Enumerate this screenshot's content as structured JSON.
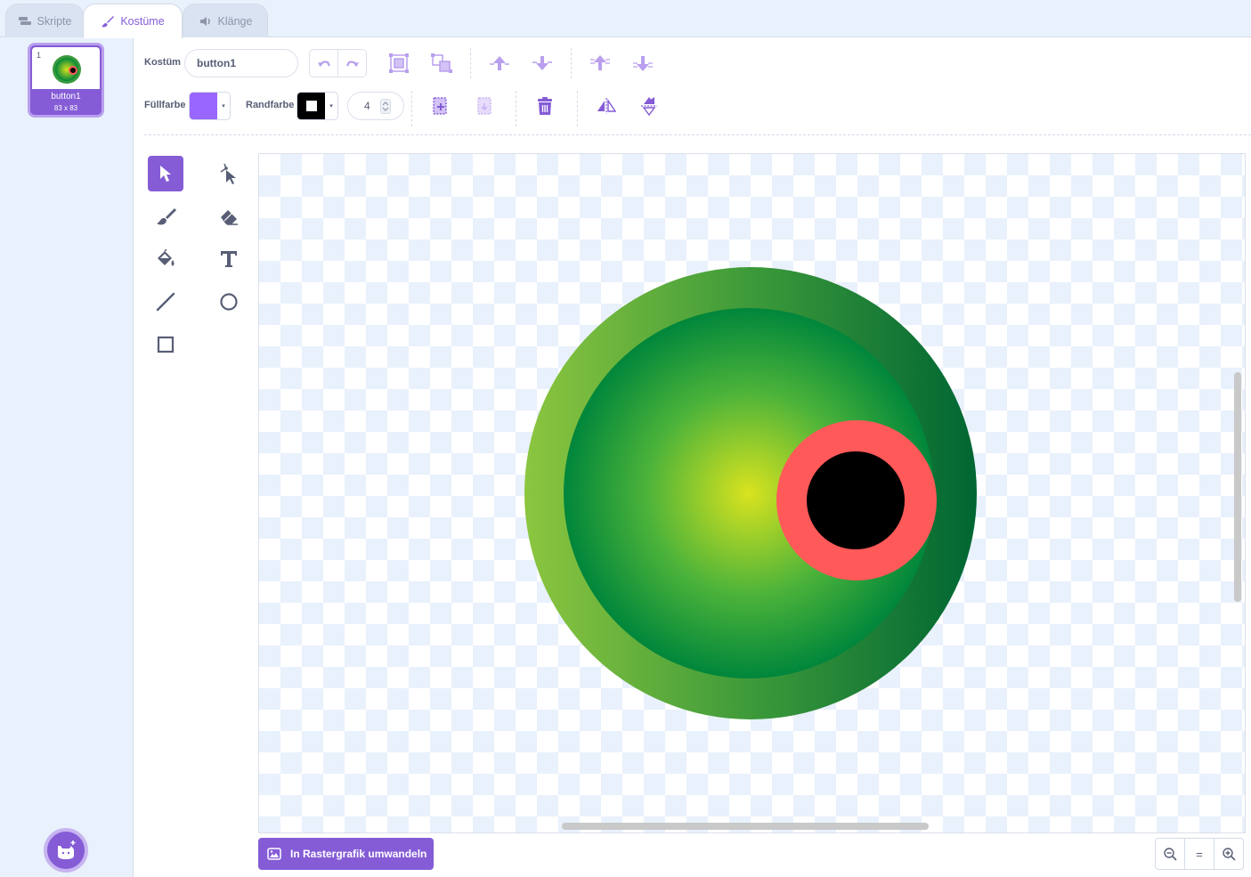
{
  "tabs": [
    {
      "label": "Skripte",
      "icon": "code-blocks-icon"
    },
    {
      "label": "Kostüme",
      "icon": "paintbrush-icon",
      "active": true
    },
    {
      "label": "Klänge",
      "icon": "speaker-icon"
    }
  ],
  "costume_list": {
    "items": [
      {
        "number": "1",
        "name": "button1",
        "size": "83 x 83",
        "selected": true
      }
    ],
    "add_button_icon": "choose-costume-cat-icon"
  },
  "toolbar": {
    "costume_label": "Kostüm",
    "costume_name": "button1",
    "fill_label": "Füllfarbe",
    "fill_color": "#9966ff",
    "outline_label": "Randfarbe",
    "outline_color": "#000000",
    "outline_width": "4",
    "buttons": [
      "undo",
      "redo",
      "group",
      "ungroup",
      "forward",
      "backward",
      "front",
      "back",
      "copy",
      "paste",
      "delete",
      "flip-horizontal",
      "flip-vertical"
    ]
  },
  "tools": [
    "select",
    "reshape",
    "brush",
    "eraser",
    "fill",
    "text",
    "line",
    "circle",
    "rectangle"
  ],
  "active_tool": "select",
  "canvas": {
    "image": "green-eye-button",
    "colors": {
      "outer_ring": "#5fb042",
      "inner_center": "#d9e31f",
      "inner_edge": "#00863b",
      "iris": "#ff5959",
      "pupil": "#000000"
    }
  },
  "footer": {
    "convert_label": "In Rastergrafik umwandeln",
    "zoom_reset_label": "="
  },
  "theme": {
    "accent": "#855cd6",
    "text": "#575e75",
    "panel_bg": "#e9f1fc"
  }
}
